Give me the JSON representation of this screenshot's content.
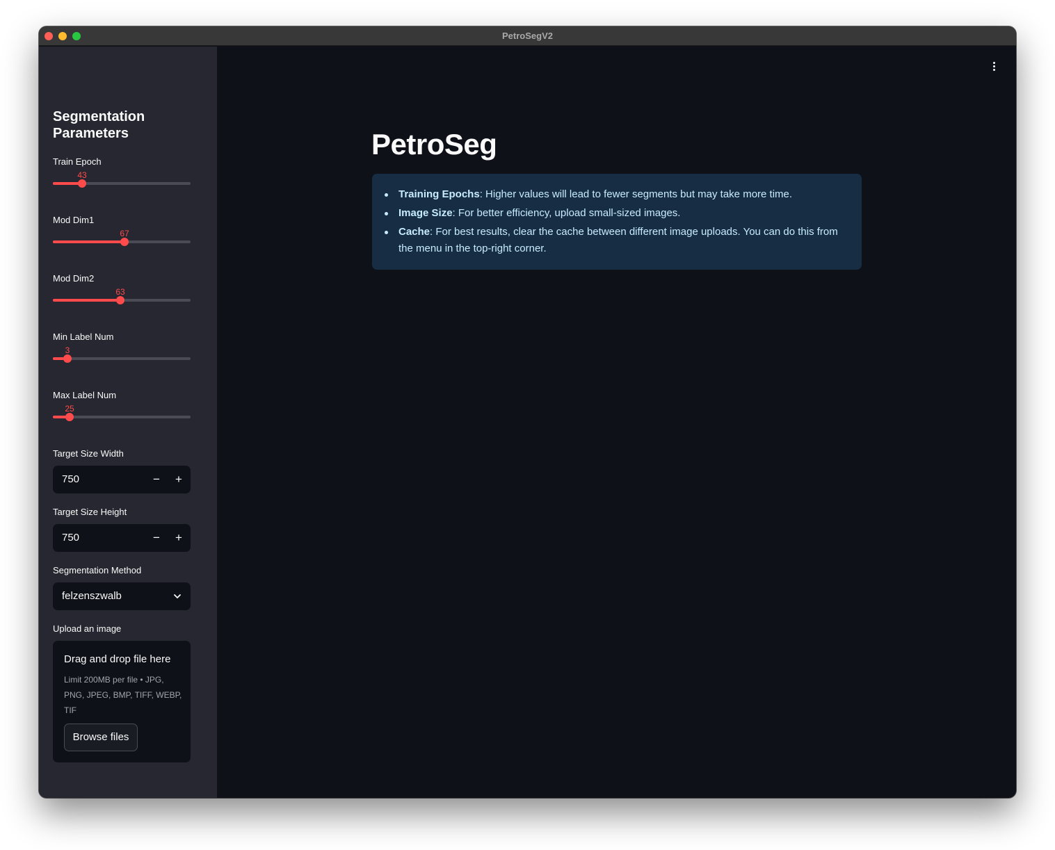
{
  "window": {
    "title": "PetroSegV2"
  },
  "sidebar": {
    "title": "Segmentation Parameters",
    "sliders": [
      {
        "label": "Train Epoch",
        "value": "43",
        "fraction": 0.21
      },
      {
        "label": "Mod Dim1",
        "value": "67",
        "fraction": 0.52
      },
      {
        "label": "Mod Dim2",
        "value": "63",
        "fraction": 0.49
      },
      {
        "label": "Min Label Num",
        "value": "3",
        "fraction": 0.105
      },
      {
        "label": "Max Label Num",
        "value": "25",
        "fraction": 0.12
      }
    ],
    "target_width": {
      "label": "Target Size Width",
      "value": "750",
      "minus": "−",
      "plus": "+"
    },
    "target_height": {
      "label": "Target Size Height",
      "value": "750",
      "minus": "−",
      "plus": "+"
    },
    "method": {
      "label": "Segmentation Method",
      "value": "felzenszwalb"
    },
    "upload": {
      "label": "Upload an image",
      "drag_text": "Drag and drop file here",
      "limit_text": "Limit 200MB per file • JPG, PNG, JPEG, BMP, TIFF, WEBP, TIF",
      "browse_label": "Browse files"
    }
  },
  "main": {
    "title": "PetroSeg",
    "info": [
      {
        "bold": "Training Epochs",
        "text": ": Higher values will lead to fewer segments but may take more time."
      },
      {
        "bold": "Image Size",
        "text": ": For better efficiency, upload small-sized images."
      },
      {
        "bold": "Cache",
        "text": ": For best results, clear the cache between different image uploads. You can do this from the menu in the top-right corner."
      }
    ]
  },
  "colors": {
    "accent": "#ff4b4b",
    "sidebar_bg": "#262730",
    "main_bg": "#0e1117",
    "info_bg": "#172d43",
    "info_text": "#c7ebff"
  },
  "icons": {
    "menu": "kebab-menu-icon",
    "dropdown": "chevron-down-icon"
  }
}
